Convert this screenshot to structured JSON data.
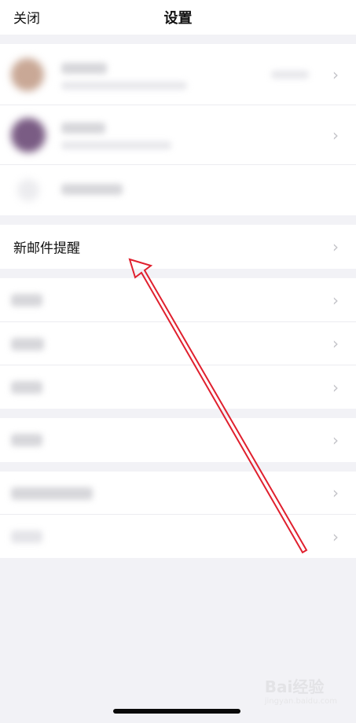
{
  "nav": {
    "close_label": "关闭",
    "title": "设置"
  },
  "account_section": {
    "rows": [
      {
        "content": "blurred-account-1"
      },
      {
        "content": "blurred-account-2"
      },
      {
        "content": "blurred-add-account"
      }
    ]
  },
  "notification_section": {
    "new_mail_reminder_label": "新邮件提醒"
  },
  "settings_section_1": {
    "rows": [
      {
        "content": "blurred-setting"
      },
      {
        "content": "blurred-setting"
      },
      {
        "content": "blurred-setting"
      }
    ]
  },
  "settings_section_2": {
    "rows": [
      {
        "content": "blurred-setting"
      }
    ]
  },
  "settings_section_3": {
    "rows": [
      {
        "content": "blurred-setting"
      },
      {
        "content": "blurred-setting"
      }
    ]
  },
  "icons": {
    "chevron": "chevron-right-icon",
    "annotation": "red-arrow-annotation"
  },
  "colors": {
    "annotation_red": "#e0202e",
    "background": "#f2f2f6",
    "chevron": "#c4c4c9"
  },
  "watermark": {
    "text": "Bai经验",
    "sub": "jingyan.baidu.com"
  }
}
